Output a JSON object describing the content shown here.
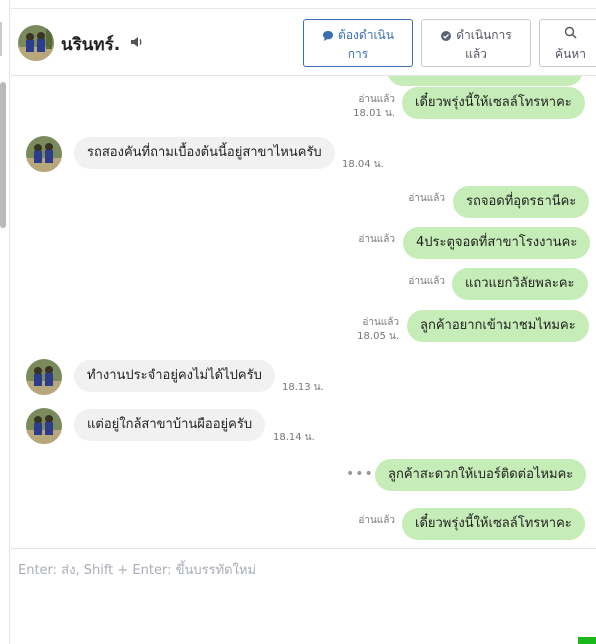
{
  "header": {
    "contact_name": "นรินทร์.",
    "btn_todo_line1": "ต้องดำเนิน",
    "btn_todo_line2": "การ",
    "btn_done_line1": "ดำเนินการ",
    "btn_done_line2": "แล้ว",
    "btn_search": "ค้นหา"
  },
  "colors": {
    "outgoing_bubble": "#c6ecb8",
    "incoming_bubble": "#f1f1f1",
    "accent_blue": "#3a6fb0",
    "send_indicator": "#1bb81b"
  },
  "messages": [
    {
      "dir": "out",
      "text": "เดี๋ยวพรุ่งนี้ให้เซลล์โทรหาคะ",
      "read": "อ่านแล้ว",
      "time": "18.01 น."
    },
    {
      "dir": "in",
      "text": "รถสองคันที่ถามเบื้องต้นนี้อยู่สาขาไหนครับ",
      "time": "18.04 น."
    },
    {
      "dir": "out",
      "text": "รถจอดที่อุดรธานีคะ",
      "read": "อ่านแล้ว"
    },
    {
      "dir": "out",
      "text": "4ประตูจอดที่สาขาโรงงานคะ",
      "read": "อ่านแล้ว"
    },
    {
      "dir": "out",
      "text": "แถวแยกวิลัยพละคะ",
      "read": "อ่านแล้ว"
    },
    {
      "dir": "out",
      "text": "ลูกค้าอยากเข้ามาชมไหมคะ",
      "read": "อ่านแล้ว",
      "time": "18.05 น."
    },
    {
      "dir": "in",
      "text": "ทำงานประจำอยู่คงไม่ได้ไปครับ",
      "time": "18.13 น."
    },
    {
      "dir": "in",
      "text": "แต่อยู่ใกล้สาขาบ้านผืออยู่ครับ",
      "time": "18.14 น."
    },
    {
      "dir": "out",
      "text": "ลูกค้าสะดวกให้เบอร์ติดต่อไหมคะ",
      "dots": "•••"
    },
    {
      "dir": "out",
      "text": "เดี๋ยวพรุ่งนี้ให้เซลล์โทรหาคะ",
      "read": "อ่านแล้ว"
    }
  ],
  "composer": {
    "placeholder": "Enter: ส่ง, Shift + Enter: ขึ้นบรรทัดใหม่",
    "value": ""
  },
  "icons": {
    "avatar": "contact-photo-icon",
    "speaker": "speaker-icon",
    "todo": "chat-bubble-icon",
    "done": "check-bubble-icon",
    "search": "search-icon"
  }
}
